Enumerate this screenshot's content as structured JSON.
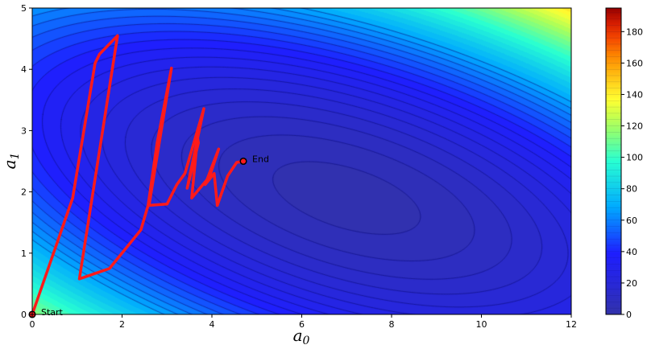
{
  "chart_data": {
    "type": "contour",
    "xlabel": "a",
    "xlabel_sub": "0",
    "ylabel": "a",
    "ylabel_sub": "1",
    "xlim": [
      0,
      12
    ],
    "ylim": [
      0,
      5
    ],
    "xticks": [
      "0",
      "2",
      "4",
      "6",
      "8",
      "10",
      "12"
    ],
    "yticks": [
      "0",
      "1",
      "2",
      "3",
      "4",
      "5"
    ],
    "colorbar": {
      "min": 0,
      "max": 195,
      "ticks": [
        "0",
        "20",
        "40",
        "60",
        "80",
        "100",
        "120",
        "140",
        "160",
        "180"
      ],
      "colormap": "jet"
    },
    "surface": {
      "minimum": {
        "x": 7.0,
        "y": 1.9
      },
      "min_value": 2,
      "max_value": 195
    },
    "path": {
      "color": "#ff1a1a",
      "points": [
        [
          0.0,
          0.0
        ],
        [
          0.9,
          1.9
        ],
        [
          1.4,
          4.1
        ],
        [
          1.5,
          4.25
        ],
        [
          1.9,
          4.55
        ],
        [
          1.05,
          0.58
        ],
        [
          1.72,
          0.75
        ],
        [
          2.42,
          1.38
        ],
        [
          2.58,
          1.78
        ],
        [
          2.78,
          2.8
        ],
        [
          3.1,
          4.02
        ],
        [
          2.6,
          1.78
        ],
        [
          3.0,
          1.8
        ],
        [
          3.22,
          2.12
        ],
        [
          3.4,
          2.3
        ],
        [
          3.82,
          3.36
        ],
        [
          3.45,
          2.06
        ],
        [
          3.7,
          2.8
        ],
        [
          3.68,
          2.88
        ],
        [
          3.55,
          1.9
        ],
        [
          3.95,
          2.25
        ],
        [
          4.15,
          2.7
        ],
        [
          3.85,
          2.12
        ],
        [
          4.05,
          2.3
        ],
        [
          4.12,
          1.78
        ],
        [
          4.35,
          2.26
        ],
        [
          4.55,
          2.48
        ],
        [
          4.7,
          2.5
        ]
      ]
    },
    "annotations": [
      {
        "label": "Start",
        "x": 0.0,
        "y": 0.0
      },
      {
        "label": "End",
        "x": 4.7,
        "y": 2.5
      }
    ]
  }
}
